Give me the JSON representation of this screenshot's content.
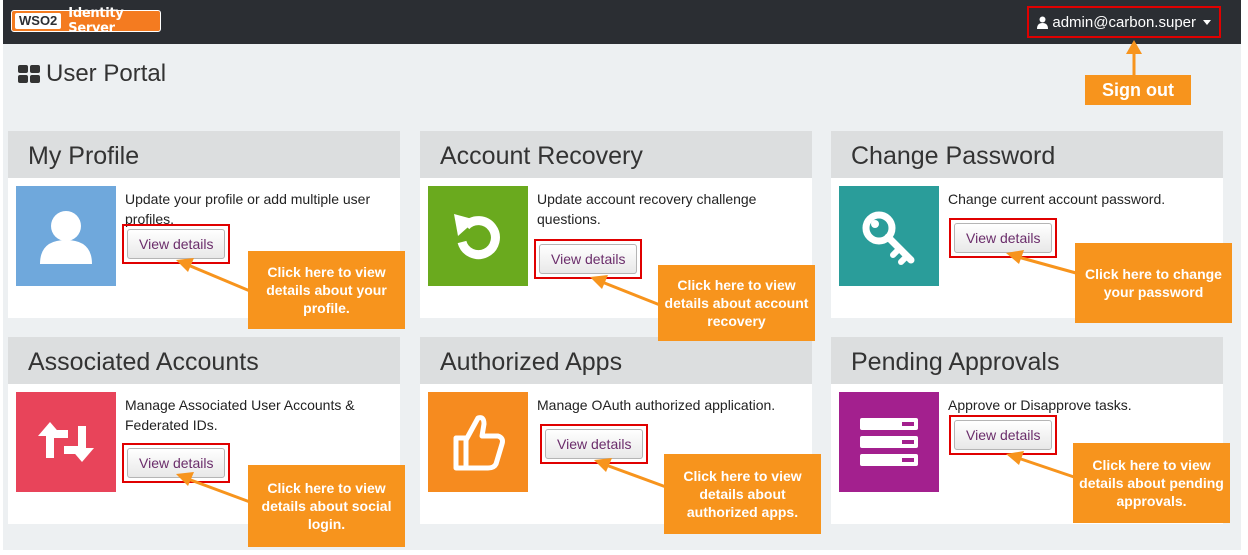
{
  "header": {
    "logo_mark": "WSO2",
    "logo_text": "Identity Server",
    "user": "admin@carbon.super"
  },
  "page": {
    "title": "User Portal"
  },
  "panels": [
    {
      "title": "My Profile",
      "description": "Update your profile or add multiple user profiles.",
      "button": "View details",
      "icon": "user-icon",
      "color": "#6fa8dc",
      "callout": "Click here to view details about your profile."
    },
    {
      "title": "Account Recovery",
      "description": "Update account recovery challenge questions.",
      "button": "View details",
      "icon": "refresh-icon",
      "color": "#6aaa1e",
      "callout": "Click here to view details about account recovery"
    },
    {
      "title": "Change Password",
      "description": "Change current account password.",
      "button": "View details",
      "icon": "key-icon",
      "color": "#2a9d9a",
      "callout": "Click here to change your password"
    },
    {
      "title": "Associated Accounts",
      "description": "Manage Associated User Accounts & Federated IDs.",
      "button": "View details",
      "icon": "retweet-icon",
      "color": "#e8445a",
      "callout": "Click here to view details about social login."
    },
    {
      "title": "Authorized Apps",
      "description": "Manage OAuth authorized application.",
      "button": "View details",
      "icon": "thumbs-up-icon",
      "color": "#f68b1f",
      "callout": "Click here to view details about authorized apps."
    },
    {
      "title": "Pending Approvals",
      "description": "Approve or Disapprove tasks.",
      "button": "View details",
      "icon": "list-icon",
      "color": "#a3208e",
      "callout": "Click here to view details about pending approvals."
    }
  ],
  "annotations": {
    "signout": "Sign out"
  }
}
